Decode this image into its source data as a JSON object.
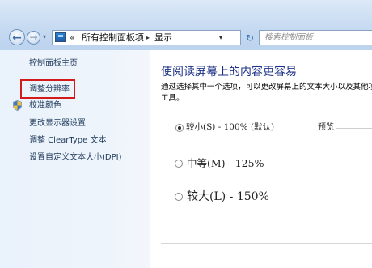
{
  "address_bar": {
    "back_glyph": "←",
    "forward_glyph": "→",
    "recent_glyph": "▾",
    "icon": "control-panel-icon",
    "overflow": "«",
    "breadcrumbs": [
      "所有控制面板项",
      "显示"
    ],
    "separator": "▸",
    "dropdown_glyph": "▾",
    "refresh_glyph": "↻",
    "search_placeholder": "搜索控制面板"
  },
  "sidebar": {
    "items": [
      {
        "label": "控制面板主页"
      },
      {
        "label": "调整分辨率"
      },
      {
        "label": "校准颜色",
        "icon": "shield-icon"
      },
      {
        "label": "更改显示器设置"
      },
      {
        "label": "调整 ClearType 文本"
      },
      {
        "label": "设置自定义文本大小(DPI)"
      }
    ],
    "highlight_color": "#d41b1b"
  },
  "main": {
    "title": "使阅读屏幕上的内容更容易",
    "description": "通过选择其中一个选项，可以更改屏幕上的文本大小以及其他项。",
    "description_line2": "工具。",
    "preview_label": "预览",
    "options": [
      {
        "label": "较小(S) - 100% (默认)",
        "selected": true
      },
      {
        "label": "中等(M) - 125%",
        "selected": false
      },
      {
        "label": "较大(L) - 150%",
        "selected": false
      }
    ],
    "title_color": "#1e3287"
  }
}
